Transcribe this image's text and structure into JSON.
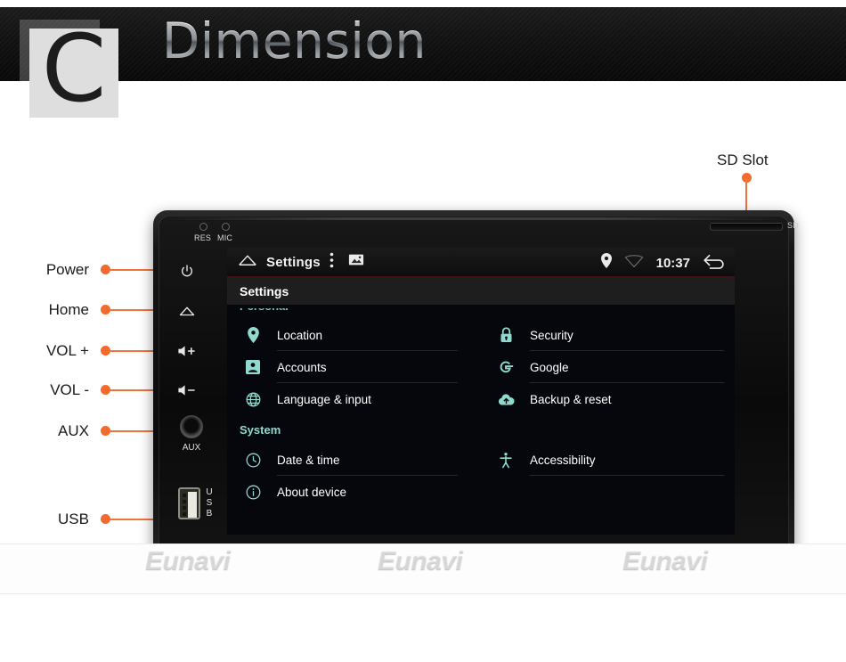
{
  "header": {
    "logo_letter": "C",
    "title": "Dimension"
  },
  "callouts": {
    "sd_slot": "SD Slot",
    "left_items": [
      {
        "label": "Power",
        "icon": "power-icon"
      },
      {
        "label": "Home",
        "icon": "home-icon"
      },
      {
        "label": "VOL +",
        "icon": "volume-up-icon"
      },
      {
        "label": "VOL -",
        "icon": "volume-down-icon"
      },
      {
        "label": "AUX",
        "icon": "aux-jack-icon"
      },
      {
        "label": "USB",
        "icon": "usb-port-icon"
      }
    ]
  },
  "device": {
    "pinholes": [
      {
        "label": "RES"
      },
      {
        "label": "MIC"
      }
    ],
    "sd_label": "SD",
    "aux_label": "AUX",
    "usb_label": "USB",
    "hw_glyphs": {
      "power": "⏻",
      "home": "home-glyph",
      "vol_up": "vol-up-glyph",
      "vol_down": "vol-down-glyph"
    }
  },
  "screen": {
    "statusbar": {
      "home_icon": "home-icon",
      "app_title": "Settings",
      "overflow_icon": "more-vertical-icon",
      "gallery_icon": "image-icon",
      "location_icon": "location-pin-icon",
      "wifi_icon": "wifi-icon",
      "clock": "10:37",
      "back_icon": "back-arrow-icon"
    },
    "page_title": "Settings",
    "clipped_section": "Personal",
    "sections": [
      {
        "name": "",
        "left": [
          {
            "label": "Location",
            "icon": "location-pin-icon"
          },
          {
            "label": "Accounts",
            "icon": "account-icon"
          },
          {
            "label": "Language & input",
            "icon": "globe-icon"
          }
        ],
        "right": [
          {
            "label": "Security",
            "icon": "lock-icon"
          },
          {
            "label": "Google",
            "icon": "google-g-icon"
          },
          {
            "label": "Backup & reset",
            "icon": "cloud-upload-icon"
          }
        ]
      },
      {
        "name": "System",
        "left": [
          {
            "label": "Date & time",
            "icon": "clock-icon"
          },
          {
            "label": "About device",
            "icon": "info-icon"
          }
        ],
        "right": [
          {
            "label": "Accessibility",
            "icon": "accessibility-icon"
          }
        ]
      }
    ]
  },
  "watermark": {
    "text": "Eunavi",
    "instances": [
      "Eunavi",
      "Eunavi",
      "Eunavi"
    ]
  },
  "colors": {
    "accent_orange": "#f26a2e",
    "icon_teal": "#8fd9ce",
    "screen_bg": "#05070c",
    "statusbar_underline": "#3d1116"
  }
}
